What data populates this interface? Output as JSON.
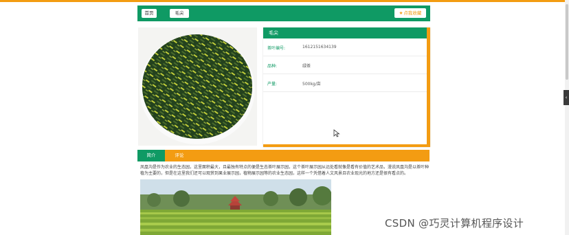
{
  "nav": {
    "home_label": "首页",
    "crumb_label": "毛尖",
    "favorite_label": "点我收藏"
  },
  "info": {
    "title": "毛尖",
    "rows": [
      {
        "label": "茶叶编号:",
        "value": "1612151634139"
      },
      {
        "label": "品种:",
        "value": "绿茶"
      },
      {
        "label": "产量:",
        "value": "500kg/亩"
      }
    ]
  },
  "tabs": {
    "intro_label": "简介",
    "review_label": "评论"
  },
  "description": "凤凰沟是作为农业的生态园，这里面积最大，且最独有特点的便是生态茶叶展示园，这个茶叶展示园从远处看就像是看有价值的艺术品，漫说凤凰沟是以茶叶种植为主要的，但是在这里我们还可以观赏到果业展示园，植物展示园等的农业生态园，这样一个凭借着人文风景且农业现光的地方还是很有看点的。",
  "watermark": "CSDN @巧灵计算机程序设计",
  "colors": {
    "brand_green": "#0f9a64",
    "accent_orange": "#f39c12"
  },
  "icons": {
    "favorite": "star-icon",
    "side_tab": "chevron-left-icon"
  }
}
